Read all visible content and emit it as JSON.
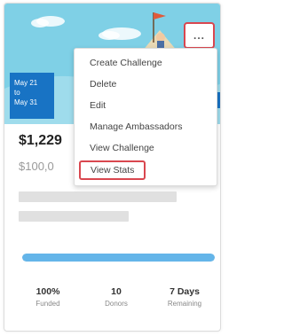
{
  "card": {
    "date_range": {
      "start": "May 21",
      "separator": "to",
      "end": "May 31"
    },
    "amount_raised": "$1,229",
    "amount_goal": "$100,0",
    "more_button_label": "...",
    "progress_fraction": 1.0,
    "stats": [
      {
        "value": "100%",
        "label": "Funded"
      },
      {
        "value": "10",
        "label": "Donors"
      },
      {
        "value": "7 Days",
        "label": "Remaining"
      }
    ]
  },
  "menu": {
    "items": [
      {
        "label": "Create Challenge"
      },
      {
        "label": "Delete"
      },
      {
        "label": "Edit"
      },
      {
        "label": "Manage Ambassadors"
      },
      {
        "label": "View Challenge"
      },
      {
        "label": "View Stats",
        "highlighted": true
      }
    ]
  },
  "colors": {
    "banner": "#7fd0e6",
    "date_badge": "#1873c4",
    "highlight_border": "#d9474f",
    "progress_fill": "#64b5e9"
  },
  "icons": [
    "more-options-icon",
    "flag-illustration-icon"
  ]
}
